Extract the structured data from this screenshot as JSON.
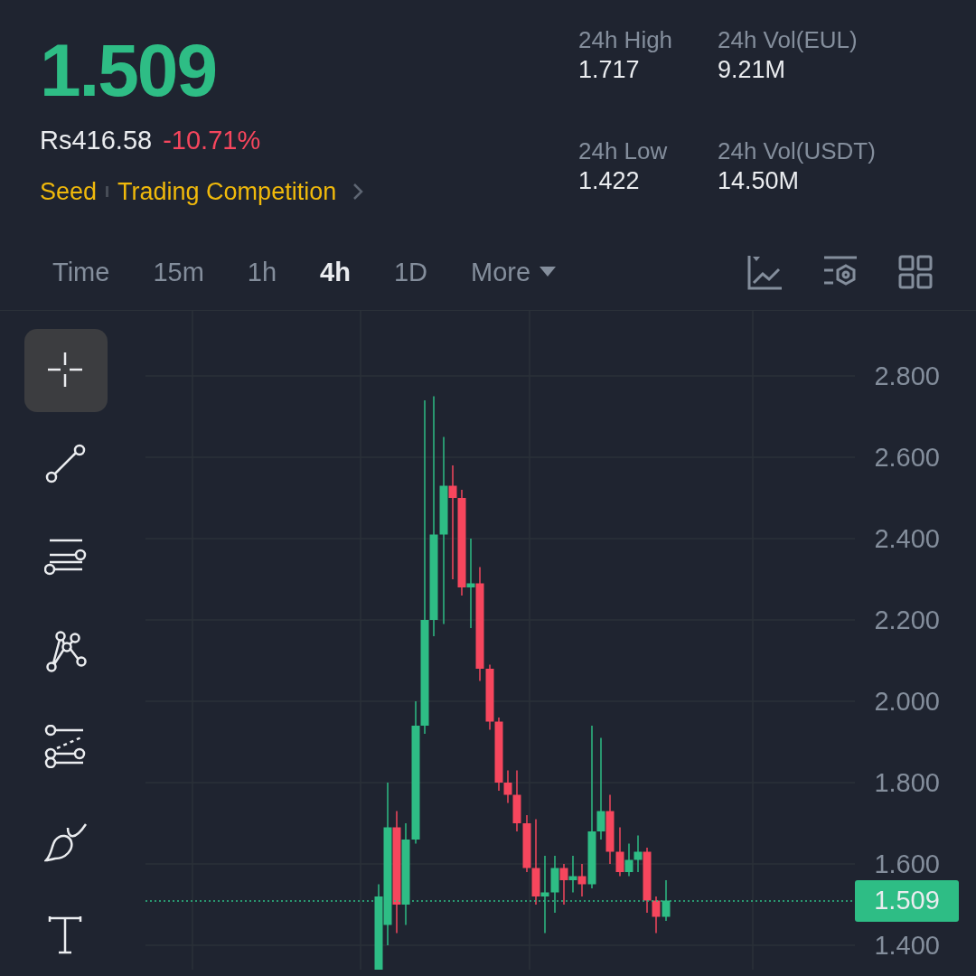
{
  "ticker": {
    "price": "1.509",
    "fiat_price": "Rs416.58",
    "change": "-10.71%",
    "tags": [
      "Seed",
      "Trading Competition"
    ]
  },
  "stats": [
    {
      "label": "24h High",
      "value": "1.717"
    },
    {
      "label": "24h Vol(EUL)",
      "value": "9.21M"
    },
    {
      "label": "24h Low",
      "value": "1.422"
    },
    {
      "label": "24h Vol(USDT)",
      "value": "14.50M"
    }
  ],
  "intervals": [
    {
      "label": "Time",
      "selected": false
    },
    {
      "label": "15m",
      "selected": false
    },
    {
      "label": "1h",
      "selected": false
    },
    {
      "label": "4h",
      "selected": true
    },
    {
      "label": "1D",
      "selected": false
    },
    {
      "label": "More",
      "selected": false
    }
  ],
  "tools": [
    {
      "kind": "crosshair",
      "selected": true
    },
    {
      "kind": "trendline",
      "selected": false
    },
    {
      "kind": "horizontal",
      "selected": false
    },
    {
      "kind": "pattern",
      "selected": false
    },
    {
      "kind": "fib",
      "selected": false
    },
    {
      "kind": "brush",
      "selected": false
    },
    {
      "kind": "text",
      "selected": false
    }
  ],
  "chart": {
    "y_labels": [
      "2.800",
      "2.600",
      "2.400",
      "2.200",
      "2.000",
      "1.800",
      "1.600",
      "1.400"
    ],
    "last_price": "1.509"
  }
}
